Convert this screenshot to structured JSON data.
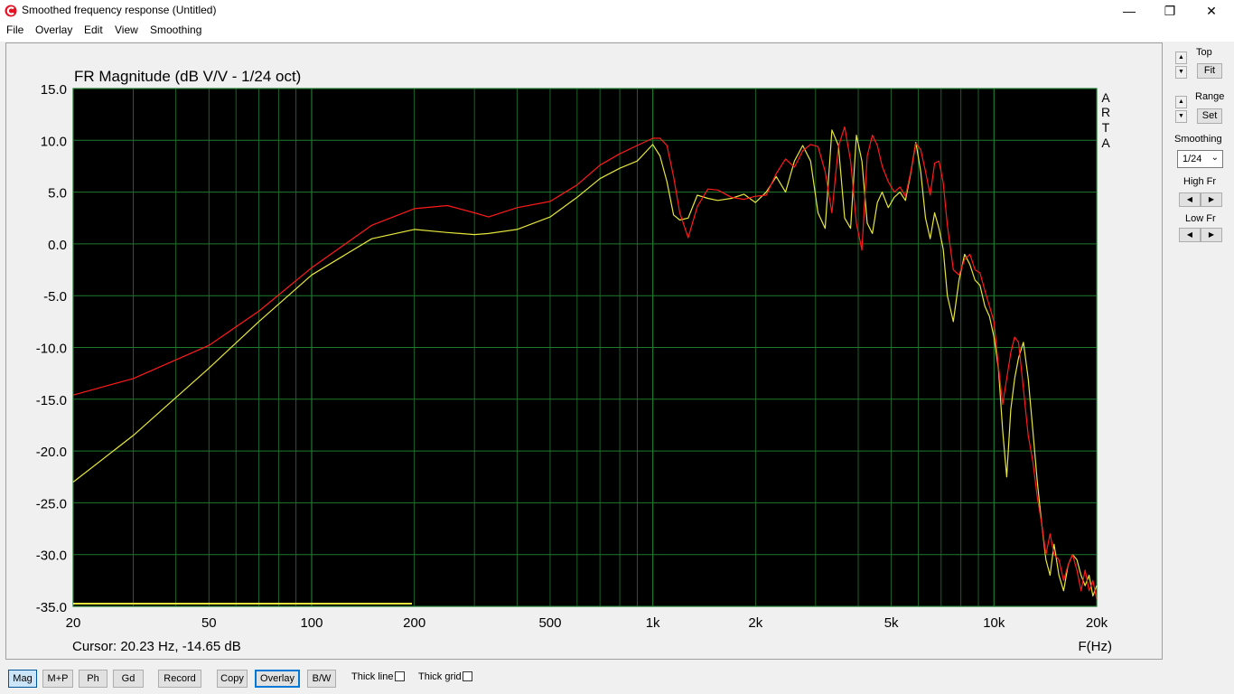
{
  "window": {
    "title": "Smoothed frequency response (Untitled)",
    "min_label": "—",
    "max_label": "❐",
    "close_label": "✕"
  },
  "menu": [
    "File",
    "Overlay",
    "Edit",
    "View",
    "Smoothing"
  ],
  "side": {
    "top_label": "Top",
    "fit_button": "Fit",
    "range_label": "Range",
    "set_button": "Set",
    "smoothing_label": "Smoothing",
    "smoothing_value": "1/24",
    "high_fr_label": "High Fr",
    "low_fr_label": "Low Fr",
    "left_arrow": "◀",
    "right_arrow": "▶",
    "up_arrow": "▲",
    "down_arrow": "▼"
  },
  "bottom_bar": {
    "buttons": [
      "Mag",
      "M+P",
      "Ph",
      "Gd",
      "Record",
      "Copy",
      "Overlay",
      "B/W"
    ],
    "active": "Mag",
    "focused": "Overlay",
    "thick_line_label": "Thick line",
    "thick_grid_label": "Thick grid"
  },
  "colors": {
    "plot_bg": "#000000",
    "grid": "#1f7a2e",
    "main_trace": "#ff1a1a",
    "overlay_trace": "#e6e63c"
  },
  "chart_data": {
    "type": "line",
    "title": "FR Magnitude (dB V/V - 1/24 oct)",
    "watermark": [
      "A",
      "R",
      "T",
      "A"
    ],
    "xlabel": "F(Hz)",
    "x_scale": "log",
    "xlim": [
      20,
      20000
    ],
    "ylim": [
      -35,
      15
    ],
    "x_ticks": [
      20,
      50,
      100,
      200,
      500,
      1000,
      2000,
      5000,
      10000,
      20000
    ],
    "x_tick_labels": [
      "20",
      "50",
      "100",
      "200",
      "500",
      "1k",
      "2k",
      "5k",
      "10k",
      "20k"
    ],
    "y_ticks": [
      15,
      10,
      5,
      0,
      -5,
      -10,
      -15,
      -20,
      -25,
      -30,
      -35
    ],
    "y_tick_labels": [
      "15.0",
      "10.0",
      "5.0",
      "0.0",
      "-5.0",
      "-10.0",
      "-15.0",
      "-20.0",
      "-25.0",
      "-30.0",
      "-35.0"
    ],
    "cursor": "Cursor: 20.23 Hz, -14.65 dB",
    "series": [
      {
        "color": "#ff1a1a",
        "x": [
          20,
          30,
          50,
          70,
          100,
          150,
          200,
          250,
          300,
          330,
          400,
          500,
          600,
          700,
          800,
          900,
          1000,
          1050,
          1100,
          1150,
          1200,
          1270,
          1350,
          1450,
          1550,
          1700,
          1850,
          2000,
          2150,
          2300,
          2450,
          2600,
          2750,
          2900,
          3050,
          3200,
          3350,
          3500,
          3650,
          3800,
          3950,
          4100,
          4250,
          4400,
          4550,
          4700,
          4900,
          5100,
          5300,
          5500,
          5700,
          5900,
          6100,
          6300,
          6500,
          6700,
          6900,
          7100,
          7300,
          7600,
          7900,
          8200,
          8500,
          8800,
          9100,
          9400,
          9700,
          10000,
          10300,
          10600,
          10900,
          11200,
          11500,
          11800,
          12200,
          12600,
          13000,
          13400,
          13800,
          14200,
          14600,
          15000,
          15500,
          16000,
          16500,
          17000,
          17500,
          18000,
          18500,
          19000,
          19500,
          20000
        ],
        "y": [
          -14.6,
          -13.0,
          -9.8,
          -6.5,
          -2.3,
          1.8,
          3.4,
          3.7,
          3.0,
          2.6,
          3.5,
          4.1,
          5.7,
          7.6,
          8.7,
          9.5,
          10.2,
          10.2,
          9.5,
          6.5,
          3.0,
          0.6,
          3.6,
          5.3,
          5.2,
          4.5,
          4.3,
          4.6,
          4.7,
          6.8,
          8.2,
          7.4,
          9.0,
          9.6,
          9.4,
          7.0,
          3.0,
          9.4,
          11.3,
          8.0,
          2.0,
          -0.6,
          8.5,
          10.5,
          9.5,
          7.5,
          6.0,
          5.0,
          5.5,
          4.6,
          6.9,
          9.7,
          9.1,
          7.0,
          4.7,
          7.8,
          8.0,
          5.9,
          1.8,
          -2.5,
          -3.0,
          -1.5,
          -1.0,
          -2.5,
          -2.8,
          -4.5,
          -6.0,
          -7.5,
          -11.8,
          -15.5,
          -13.0,
          -10.5,
          -9.0,
          -9.5,
          -14.0,
          -18.5,
          -21.0,
          -24.5,
          -27.0,
          -30.0,
          -28.0,
          -30.0,
          -30.5,
          -32.5,
          -31.0,
          -30.0,
          -31.5,
          -33.5,
          -31.5,
          -33.5,
          -32.5,
          -34.3
        ]
      },
      {
        "color": "#e6e63c",
        "x": [
          20,
          30,
          50,
          70,
          100,
          150,
          200,
          250,
          300,
          330,
          400,
          500,
          600,
          700,
          800,
          900,
          1000,
          1050,
          1100,
          1150,
          1200,
          1270,
          1350,
          1450,
          1550,
          1700,
          1850,
          2000,
          2150,
          2300,
          2450,
          2600,
          2750,
          2900,
          3050,
          3200,
          3350,
          3500,
          3650,
          3800,
          3950,
          4100,
          4250,
          4400,
          4550,
          4700,
          4900,
          5100,
          5300,
          5500,
          5700,
          5900,
          6100,
          6300,
          6500,
          6700,
          6900,
          7100,
          7300,
          7600,
          7900,
          8200,
          8500,
          8800,
          9100,
          9400,
          9700,
          10000,
          10300,
          10600,
          10900,
          11200,
          11500,
          11800,
          12200,
          12600,
          13000,
          13400,
          13800,
          14200,
          14600,
          15000,
          15500,
          16000,
          16500,
          17000,
          17500,
          18000,
          18500,
          19000,
          19500,
          20000
        ],
        "y": [
          -23.0,
          -18.5,
          -12.0,
          -7.5,
          -3.0,
          0.5,
          1.4,
          1.1,
          0.9,
          1.0,
          1.4,
          2.6,
          4.5,
          6.3,
          7.3,
          8.0,
          9.6,
          8.5,
          6.0,
          2.8,
          2.3,
          2.5,
          4.7,
          4.4,
          4.2,
          4.4,
          4.8,
          4.0,
          5.0,
          6.5,
          5.0,
          8.0,
          9.5,
          8.0,
          3.0,
          1.5,
          11.0,
          9.5,
          2.5,
          1.5,
          10.5,
          8.0,
          2.0,
          1.0,
          4.0,
          5.0,
          3.5,
          4.5,
          5.0,
          4.2,
          6.8,
          9.8,
          7.0,
          2.5,
          0.5,
          3.0,
          1.5,
          -0.5,
          -5.0,
          -7.5,
          -3.5,
          -1.0,
          -2.0,
          -3.5,
          -4.0,
          -6.0,
          -7.0,
          -9.0,
          -12.0,
          -18.0,
          -22.5,
          -16.0,
          -13.0,
          -11.0,
          -9.5,
          -13.0,
          -18.0,
          -23.0,
          -27.0,
          -30.5,
          -32.0,
          -29.0,
          -32.0,
          -33.5,
          -31.0,
          -30.0,
          -30.5,
          -32.0,
          -33.0,
          -32.0,
          -34.0,
          -33.0
        ]
      }
    ]
  }
}
